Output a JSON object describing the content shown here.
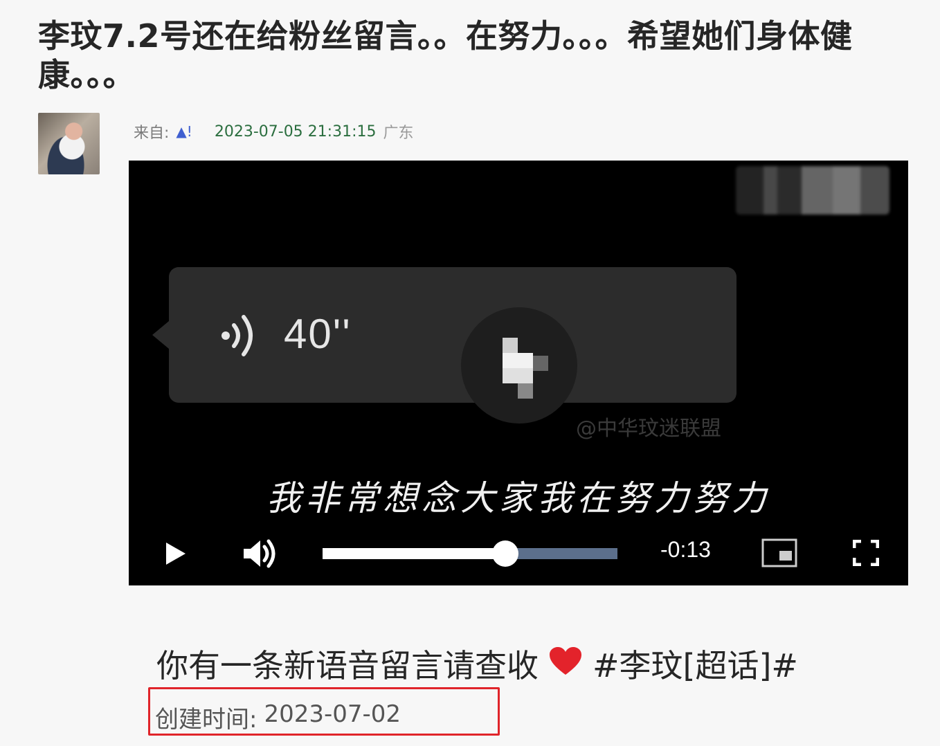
{
  "post": {
    "title": "李玟7.2号还在给粉丝留言。。在努力。。。希望她们身体健康。。。",
    "source_label": "来自:",
    "timestamp": "2023-07-05 21:31:15",
    "location": "广东"
  },
  "video": {
    "voice_duration": "40''",
    "watermark": "@中华玟迷联盟",
    "caption": "我非常想念大家我在努力努力",
    "time_remaining": "-0:13",
    "progress": 0.62
  },
  "body": {
    "text": "你有一条新语音留言请查收",
    "hashtag": "#李玟[超话]#"
  },
  "created": {
    "label": "创建时间:",
    "date": "2023-07-02"
  },
  "colors": {
    "highlight_border": "#e0242a",
    "timestamp": "#2b6e3f",
    "track": "#5c6f8c"
  }
}
